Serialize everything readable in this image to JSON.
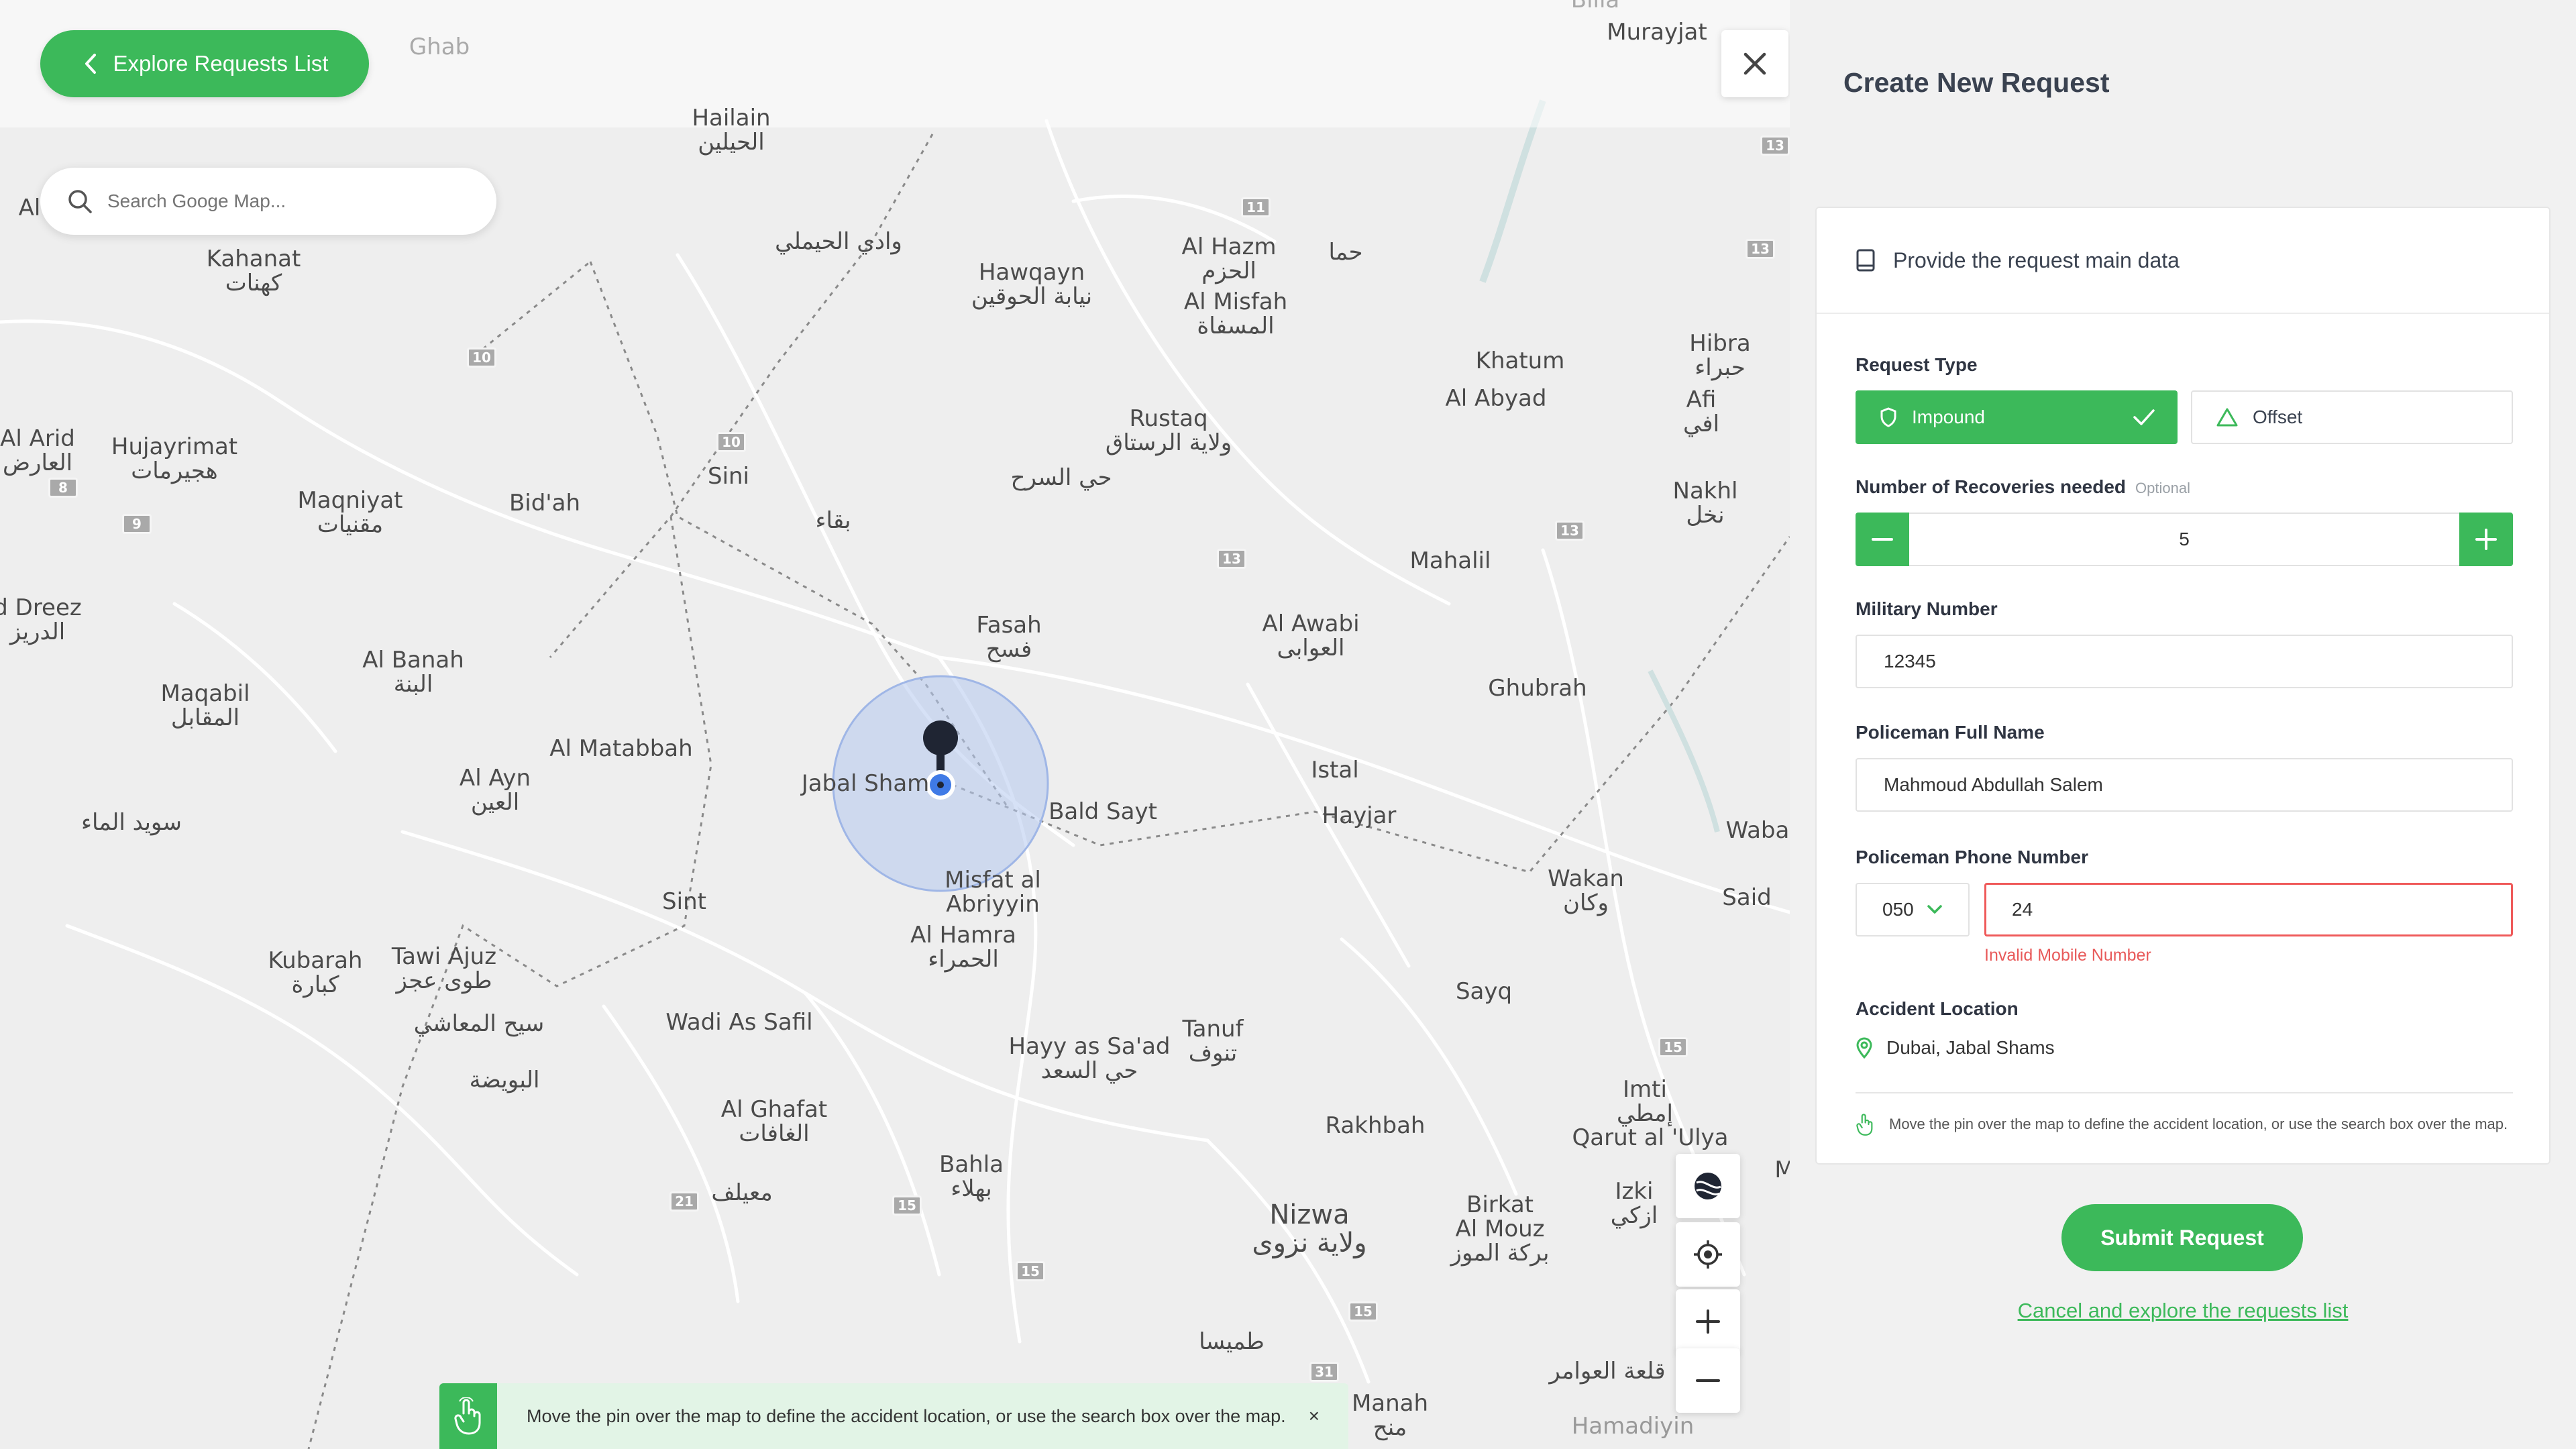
{
  "colors": {
    "accent": "#3cb95a",
    "error": "#e85a5a",
    "panel_bg": "#f1f1f1",
    "map_bg": "#eeeeee"
  },
  "map": {
    "explore_label": "Explore Requests List",
    "search_placeholder": "Search Googe Map...",
    "labels": {
      "ghab": "Ghab",
      "billa": "Billa",
      "murayjat": "Murayjat",
      "hailain": "Hailain",
      "hailain_ar": "الحيلين",
      "al_top": "Al",
      "kahanat": "Kahanat",
      "kahanat_ar": "كهنات",
      "wadi_hymli_ar": "وادي الحيملي",
      "hawqayn": "Hawqayn",
      "hawqayn_ar": "نيابة الحوقين",
      "al_hazm": "Al Hazm",
      "al_hazm_ar": "الحزم",
      "al_misfah": "Al Misfah",
      "al_misfah_ar": "المسفاة",
      "hama_ar": "حما",
      "khatum": "Khatum",
      "al_abyad": "Al Abyad",
      "hibra": "Hibra",
      "hibra_ar": "حبراء",
      "afi": "Afi",
      "afi_ar": "افي",
      "al_arid": "Al Arid",
      "al_arid_ar": "العارض",
      "hujayrimat": "Hujayrimat",
      "hujayrimat_ar": "هجيرمات",
      "sini": "Sini",
      "rustaq": "Rustaq",
      "rustaq_ar": "ولاية الرستاق",
      "hay_sarh_ar": "حي السرح",
      "nakhl": "Nakhl",
      "nakhl_ar": "نخل",
      "maqniyat": "Maqniyat",
      "maqniyat_ar": "مقنيات",
      "bidah": "Bid'ah",
      "baqa_ar": "بقاء",
      "mahalil": "Mahalil",
      "d_dreez": "d Dreez",
      "d_dreez_ar": "الدريز",
      "fasah": "Fasah",
      "fasah_ar": "فسح",
      "al_awabi": "Al Awabi",
      "al_awabi_ar": "العوابى",
      "al_banah": "Al Banah",
      "al_banah_ar": "البنة",
      "maqabil": "Maqabil",
      "maqabil_ar": "المقابل",
      "ghubrah": "Ghubrah",
      "al_matabbah": "Al Matabbah",
      "al_ayn": "Al Ayn",
      "al_ayn_ar": "العين",
      "jabal_shams": "Jabal Sham",
      "istal": "Istal",
      "bald_sayt": "Bald Sayt",
      "hayjar": "Hayjar",
      "suwaid_ar": "سويد الماء",
      "waba": "Waba",
      "misfat": "Misfat al",
      "misfat2": "Abriyyin",
      "wakan": "Wakan",
      "wakan_ar": "وكان",
      "said": "Said",
      "sint": "Sint",
      "al_hamra": "Al Hamra",
      "al_hamra_ar": "الحمراء",
      "kubarah": "Kubarah",
      "kubarah_ar": "كبارة",
      "tawi_ajuz": "Tawi Ajuz",
      "tawi_ajuz_ar": "طوى عجز",
      "sayq": "Sayq",
      "sayh_ar": "سيح المعاشي",
      "wadi_safil": "Wadi As Safil",
      "tanuf": "Tanuf",
      "tanuf_ar": "تنوف",
      "hayy_saad": "Hayy as Sa'ad",
      "hayy_saad_ar": "حي السعد",
      "buwaydah_ar": "البويضة",
      "imti": "Imti",
      "imti_ar": "إمطي",
      "qarut": "Qarut al 'Ulya",
      "al_ghafat": "Al Ghafat",
      "al_ghafat_ar": "الغافات",
      "rakhbah": "Rakhbah",
      "bahla": "Bahla",
      "bahla_ar": "بهلاء",
      "muaylah_ar": "معيلف",
      "izki": "Izki",
      "izki_ar": "ازكي",
      "birkat": "Birkat",
      "al_mouz": "Al Mouz",
      "birkat_ar": "بركة الموز",
      "nizwa": "Nizwa",
      "nizwa_ar": "ولاية نزوى",
      "tumaysa_ar": "طميسا",
      "qalat_ar": "قلعة العوامر",
      "manah": "Manah",
      "manah_ar": "منح",
      "hamadiyin": "Hamadiyin",
      "m_edge": "M"
    },
    "shields": [
      "13",
      "11",
      "13",
      "10",
      "10",
      "8",
      "9",
      "13",
      "13",
      "15",
      "21",
      "15",
      "15",
      "15",
      "31"
    ],
    "hint": "Move the pin over the map to define the accident location, or use the search box over the map.",
    "hint_close": "×"
  },
  "panel": {
    "title": "Create New Request",
    "section_title": "Provide the request main data",
    "request_type_label": "Request Type",
    "type_impound": "Impound",
    "type_offset": "Offset",
    "recoveries_label": "Number of Recoveries needed",
    "recoveries_optional": "Optional",
    "recoveries_value": "5",
    "military_label": "Military Number",
    "military_value": "12345",
    "policeman_name_label": "Policeman Full Name",
    "policeman_name_value": "Mahmoud Abdullah Salem",
    "phone_label": "Policeman Phone Number",
    "phone_code": "050",
    "phone_value": "24",
    "phone_error": "Invalid Mobile Number",
    "location_label": "Accident Location",
    "location_value": "Dubai, Jabal Shams",
    "location_hint": "Move the pin over the map to define the accident location, or use the search box over the map.",
    "submit_label": "Submit Request",
    "cancel_label": "Cancel and explore the requests list"
  }
}
